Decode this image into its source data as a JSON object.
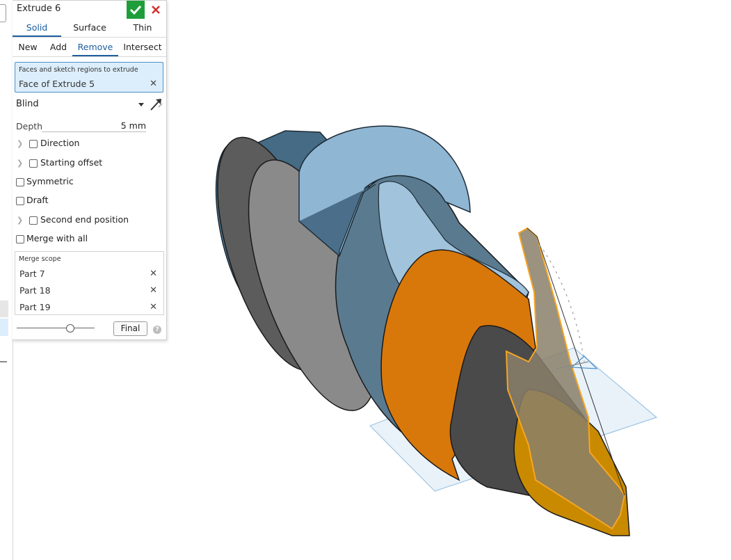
{
  "feature": {
    "title": "Extrude 6",
    "accept_icon": "checkmark-icon",
    "cancel_icon": "close-icon"
  },
  "body_type_tabs": [
    "Solid",
    "Surface",
    "Thin"
  ],
  "operation_tabs": [
    "New",
    "Add",
    "Remove",
    "Intersect"
  ],
  "selection": {
    "label": "Faces and sketch regions to extrude",
    "value": "Face of Extrude 5"
  },
  "end_type": {
    "value": "Blind",
    "flip_icon": "flip-direction-icon"
  },
  "depth": {
    "label": "Depth",
    "value": "5 mm"
  },
  "options": {
    "direction": "Direction",
    "starting_offset": "Starting offset",
    "symmetric": "Symmetric",
    "draft": "Draft",
    "second_end": "Second end position",
    "merge_with_all": "Merge with all"
  },
  "merge_scope": {
    "label": "Merge scope",
    "items": [
      "Part 7",
      "Part 18",
      "Part 19"
    ]
  },
  "footer": {
    "final_label": "Final",
    "help_icon": "help-icon",
    "help_glyph": "?",
    "remove_glyph": "✕"
  },
  "colors": {
    "accent": "#1b5e9e",
    "accept": "#1f9d3a",
    "cancel": "#d32f2f",
    "selection_bg": "#dceefb",
    "part_blue": "#5b88a8",
    "part_orange": "#d9780a",
    "part_gray": "#6e6e6e",
    "highlight": "#f5a623"
  }
}
